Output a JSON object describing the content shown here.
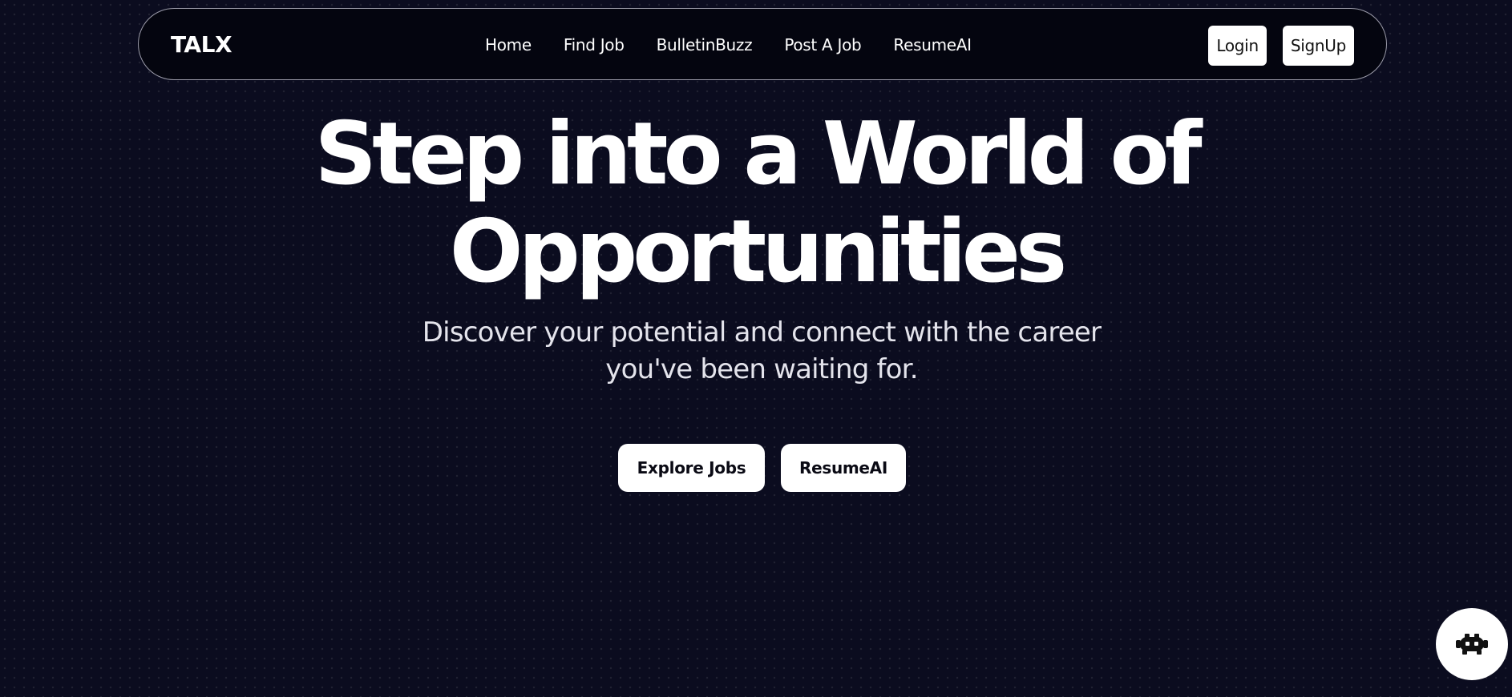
{
  "nav": {
    "brand": "TALX",
    "links": [
      "Home",
      "Find Job",
      "BulletinBuzz",
      "Post A Job",
      "ResumeAI"
    ],
    "login_label": "Login",
    "signup_label": "SignUp"
  },
  "hero": {
    "title_line1": "Step into a World of",
    "title_line2": "Opportunities",
    "subtitle_line1": "Discover your potential and connect with the career",
    "subtitle_line2": "you've been waiting for.",
    "explore_label": "Explore Jobs",
    "resume_label": "ResumeAI"
  },
  "chat_widget": {
    "icon": "bot-icon"
  },
  "colors": {
    "background": "#0b0c1f",
    "navbar": "#04050f",
    "button": "#ffffff",
    "button_text": "#0a0a14"
  }
}
